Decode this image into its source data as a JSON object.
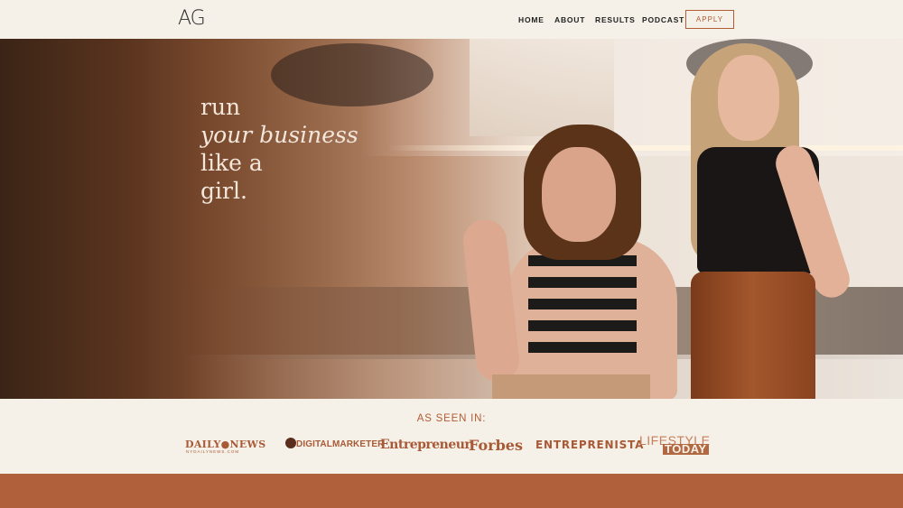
{
  "header": {
    "logo": "AG",
    "nav": {
      "home": "HOME",
      "about": "ABOUT",
      "results": "RESULTS",
      "podcast": "PODCAST"
    },
    "apply": "APPLY"
  },
  "hero": {
    "line1": "run",
    "line2": "your business",
    "line3": "like a",
    "line4": "girl."
  },
  "press": {
    "title": "AS SEEN IN:",
    "logos": {
      "daily_news": "DAILY●NEWS",
      "daily_news_sub": "NYDAILYNEWS.COM",
      "digital_marketer": "DIGITALMARKETER",
      "entrepreneur": "Entrepreneur",
      "forbes": "Forbes",
      "entreprenista": "ENTREPRENISTA",
      "lifestyle": "LIFESTYLE",
      "today": "TODAY"
    }
  },
  "colors": {
    "accent": "#b05c34",
    "background": "#f6f1e8",
    "footer_band": "#b0603a"
  }
}
